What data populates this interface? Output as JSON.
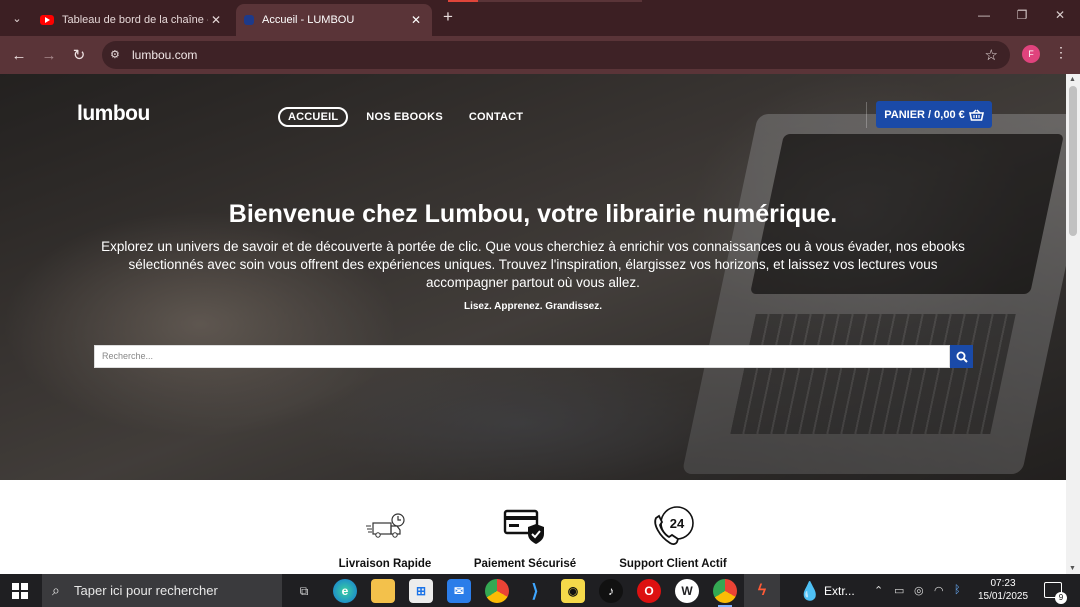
{
  "browser": {
    "tabs": [
      {
        "title": "Tableau de bord de la chaîne -",
        "favicon": "youtube-icon",
        "active": false
      },
      {
        "title": "Accueil - LUMBOU",
        "favicon": "lumbou-favicon",
        "active": true
      }
    ],
    "url": "lumbou.com",
    "profile_initial": "F"
  },
  "site": {
    "logo": "lumbou",
    "nav": [
      "ACCUEIL",
      "NOS EBOOKS",
      "CONTACT"
    ],
    "cart_label": "PANIER / 0,00 €",
    "accent_color": "#1a4aa8"
  },
  "hero": {
    "title": "Bienvenue chez Lumbou, votre librairie numérique.",
    "text": "Explorez un univers de savoir et de découverte à portée de clic. Que vous cherchiez à enrichir vos connaissances ou à vous évader, nos ebooks sélectionnés avec soin vous offrent des expériences uniques. Trouvez l'inspiration, élargissez vos horizons, et laissez vos lectures vous accompagner partout où vous allez.",
    "tagline": "Lisez. Apprenez. Grandissez.",
    "search_placeholder": "Recherche..."
  },
  "features": [
    {
      "label": "Livraison Rapide",
      "icon": "delivery-truck-icon"
    },
    {
      "label": "Paiement Sécurisé",
      "icon": "secure-card-icon"
    },
    {
      "label": "Support Client Actif",
      "icon": "phone-24-icon"
    }
  ],
  "taskbar": {
    "search_placeholder": "Taper ici pour rechercher",
    "weather_label": "Extr...",
    "time": "07:23",
    "date": "15/01/2025",
    "notification_count": "9"
  }
}
